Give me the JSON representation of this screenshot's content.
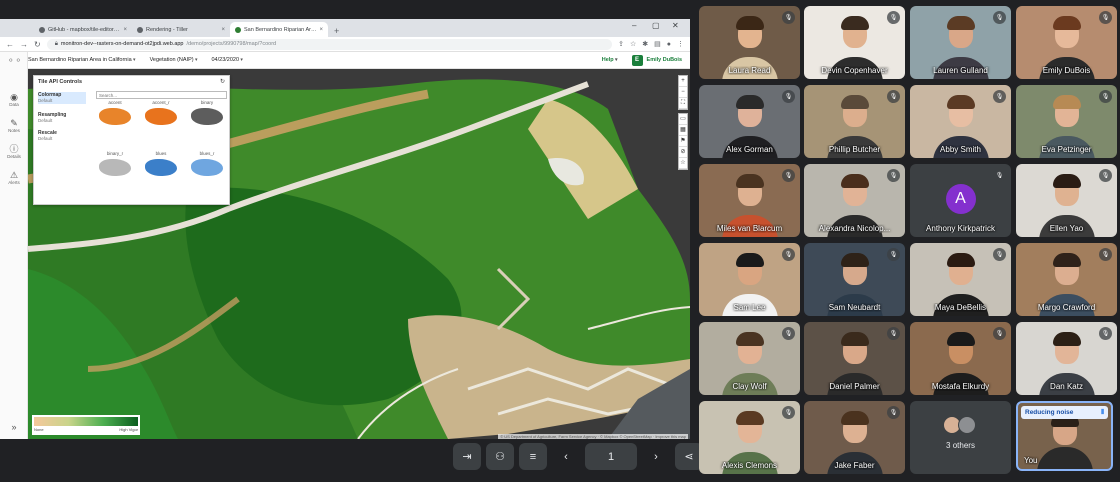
{
  "browser": {
    "tabs": [
      {
        "label": "GitHub - mapbox/tile-editor: Cl..."
      },
      {
        "label": "Rendering - Tiller"
      },
      {
        "label": "San Bernardino Riparian Area in..."
      }
    ],
    "url_host": "monitron-dev--rasters-on-demand-ot2jpdi.web.app",
    "url_path": "/demo/projects/9990798/map/?coord"
  },
  "app": {
    "project": "San Bernardino Riparian Area in California",
    "layer": "Vegetation (NAIP)",
    "date": "04/23/2020",
    "help": "Help",
    "user_initial": "E",
    "user": "Emily DuBois",
    "rail": [
      {
        "icon": "camera-icon",
        "label": "Data"
      },
      {
        "icon": "edit-icon",
        "label": "Notes"
      },
      {
        "icon": "info-icon",
        "label": "Details"
      },
      {
        "icon": "alert-icon",
        "label": "Alerts"
      }
    ]
  },
  "tile_panel": {
    "title": "Tile API Controls",
    "options": [
      {
        "title": "Colormap",
        "sub": "Default"
      },
      {
        "title": "Resampling",
        "sub": "Default"
      },
      {
        "title": "Rescale",
        "sub": "Default"
      }
    ],
    "search_placeholder": "Search...",
    "colormaps": [
      {
        "name": "accent",
        "color": "#e8842a"
      },
      {
        "name": "accent_r",
        "color": "#e8731d"
      },
      {
        "name": "binary",
        "color": "#5d5d5d"
      },
      {
        "name": "binary_r",
        "color": "#b8b8b8"
      },
      {
        "name": "blues",
        "color": "#3b7fc9"
      },
      {
        "name": "blues_r",
        "color": "#6fa6e0"
      }
    ]
  },
  "legend": {
    "min": "None",
    "max": "High Vigor"
  },
  "map": {
    "attribution": "© US Department of Agriculture, Farm Service Agency · © Mapbox © OpenStreetMap · Improve this map",
    "logo": "mapbox"
  },
  "meet": {
    "page_number": "1",
    "participants": [
      {
        "name": "Laura Read",
        "bg": "#6f5b48",
        "skin": "#e3b48f",
        "shirt": "#d9c6a4",
        "hair": "#3b2716"
      },
      {
        "name": "Devin Copenhaver",
        "bg": "#ece8e2",
        "skin": "#e1b28f",
        "shirt": "#2d2d2d",
        "hair": "#3a2b1f"
      },
      {
        "name": "Lauren Gulland",
        "bg": "#8fa2a8",
        "skin": "#d9a788",
        "shirt": "#3d3b44",
        "hair": "#5b3b24"
      },
      {
        "name": "Emily DuBois",
        "bg": "#b68c6f",
        "skin": "#e6b99a",
        "shirt": "#2b2b2b",
        "hair": "#6b3a1f"
      },
      {
        "name": "Alex Gorman",
        "bg": "#6a6e73",
        "skin": "#dfb29a",
        "shirt": "#1f1f22",
        "hair": "#2a2a2a"
      },
      {
        "name": "Phillip Butcher",
        "bg": "#a69476",
        "skin": "#dcae8d",
        "shirt": "#3a3a3a",
        "hair": "#5a4a3a"
      },
      {
        "name": "Abby Smith",
        "bg": "#c9b7a2",
        "skin": "#e7bea3",
        "shirt": "#2f3340",
        "hair": "#5b3a24"
      },
      {
        "name": "Eva Petzinger",
        "bg": "#7e8a6c",
        "skin": "#e2b496",
        "shirt": "#4a5960",
        "hair": "#b78a54"
      },
      {
        "name": "Miles van Blarcum",
        "bg": "#8a6b52",
        "skin": "#deb191",
        "shirt": "#c7512e",
        "hair": "#4a3320"
      },
      {
        "name": "Alexandra Nicolop...",
        "bg": "#b9b6ad",
        "skin": "#e1b396",
        "shirt": "#2a2a2a",
        "hair": "#4a2e1c"
      },
      {
        "name": "Anthony Kirkpatrick",
        "avatar": true,
        "initial": "A",
        "avatar_color": "#8430ce"
      },
      {
        "name": "Ellen Yao",
        "bg": "#dcd9d3",
        "skin": "#dfb291",
        "shirt": "#3b3b3b",
        "hair": "#2a1c14"
      },
      {
        "name": "Sam Lee",
        "bg": "#bfa384",
        "skin": "#d9a581",
        "shirt": "#f2f2f2",
        "hair": "#1a1a1a"
      },
      {
        "name": "Sam Neubardt",
        "bg": "#3e4a57",
        "skin": "#d6a98c",
        "shirt": "#2c3b4a",
        "hair": "#2e2218"
      },
      {
        "name": "Maya DeBellis",
        "bg": "#c6c1b7",
        "skin": "#e0b090",
        "shirt": "#1f1f1f",
        "hair": "#2b1b12"
      },
      {
        "name": "Margo Crawford",
        "bg": "#a27e5d",
        "skin": "#dcae90",
        "shirt": "#3c4e60",
        "hair": "#2f221a"
      },
      {
        "name": "Clay Wolf",
        "bg": "#b2ad9f",
        "skin": "#e2b294",
        "shirt": "#6e7d58",
        "hair": "#4a3422"
      },
      {
        "name": "Daniel Palmer",
        "bg": "#5c5147",
        "skin": "#d9a889",
        "shirt": "#2a2a2a",
        "hair": "#3a2a1c"
      },
      {
        "name": "Mostafa Elkurdy",
        "bg": "#8b6a4e",
        "skin": "#c98f63",
        "shirt": "#1d1d1d",
        "hair": "#1a1a1a"
      },
      {
        "name": "Dan Katz",
        "bg": "#d8d6d1",
        "skin": "#e2b598",
        "shirt": "#3b3f45",
        "hair": "#2c2016"
      },
      {
        "name": "Alexis Clemons",
        "bg": "#c8c2b2",
        "skin": "#e3b597",
        "shirt": "#58734a",
        "hair": "#5a3a22"
      },
      {
        "name": "Jake Faber",
        "bg": "#6f5b4b",
        "skin": "#ddb192",
        "shirt": "#2a2f35",
        "hair": "#4a321e"
      }
    ],
    "others_label": "3 others",
    "you": {
      "name": "You",
      "status": "Reducing noise",
      "bg": "#78624c",
      "skin": "#d7a687",
      "shirt": "#2a2a2a",
      "hair": "#2a2018"
    }
  }
}
